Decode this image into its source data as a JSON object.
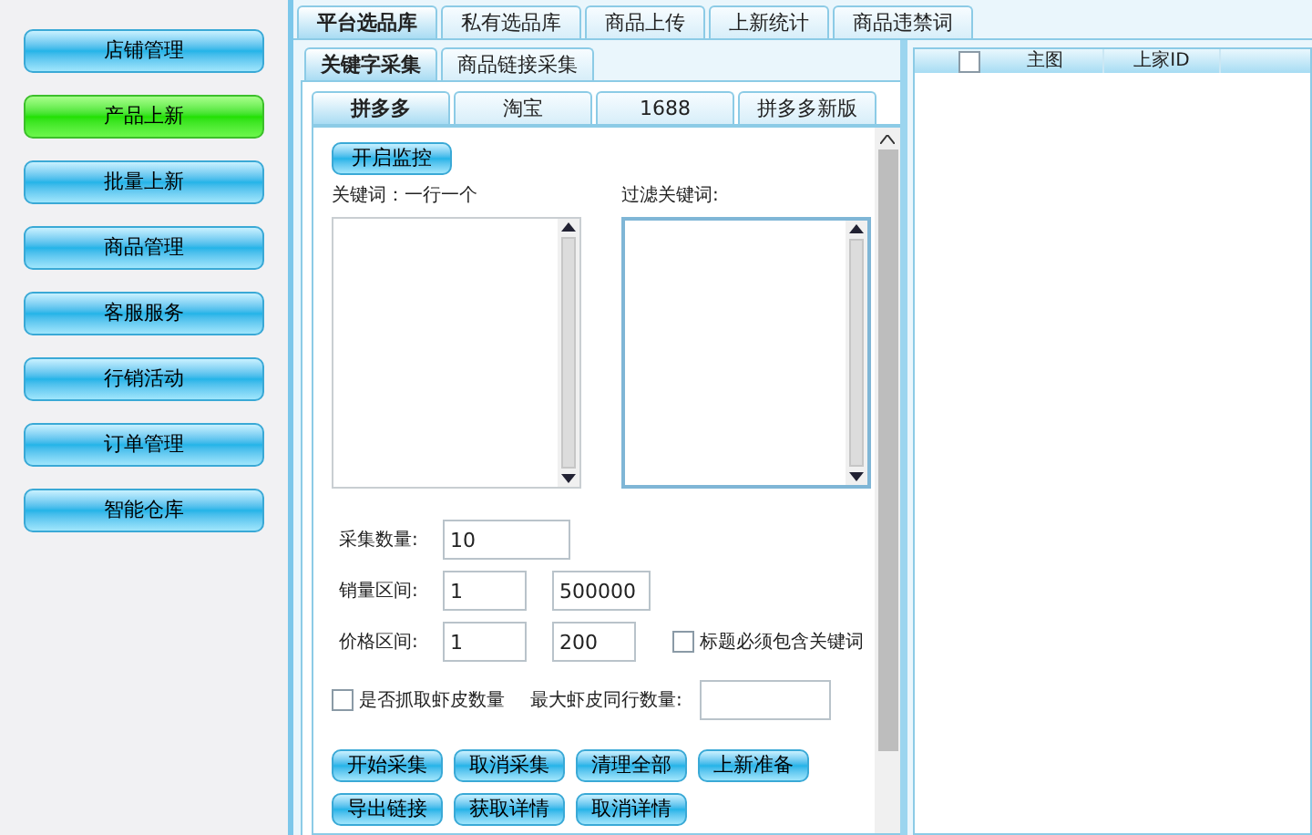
{
  "sidebar": {
    "items": [
      {
        "label": "店铺管理",
        "selected": false
      },
      {
        "label": "产品上新",
        "selected": true
      },
      {
        "label": "批量上新",
        "selected": false
      },
      {
        "label": "商品管理",
        "selected": false
      },
      {
        "label": "客服服务",
        "selected": false
      },
      {
        "label": "行销活动",
        "selected": false
      },
      {
        "label": "订单管理",
        "selected": false
      },
      {
        "label": "智能仓库",
        "selected": false
      }
    ]
  },
  "top_tabs": [
    {
      "label": "平台选品库",
      "selected": true
    },
    {
      "label": "私有选品库",
      "selected": false
    },
    {
      "label": "商品上传",
      "selected": false
    },
    {
      "label": "上新统计",
      "selected": false
    },
    {
      "label": "商品违禁词",
      "selected": false
    }
  ],
  "sub_tabs": [
    {
      "label": "关键字采集",
      "selected": true
    },
    {
      "label": "商品链接采集",
      "selected": false
    }
  ],
  "platform_tabs": [
    {
      "label": "拼多多",
      "selected": true
    },
    {
      "label": "淘宝",
      "selected": false
    },
    {
      "label": "1688",
      "selected": false
    },
    {
      "label": "拼多多新版",
      "selected": false
    }
  ],
  "monitor_button": "开启监控",
  "keywords_label": "关键词：一行一个",
  "filter_keywords_label": "过滤关键词:",
  "collect_count": {
    "label": "采集数量:",
    "value": "10"
  },
  "sales_range": {
    "label": "销量区间:",
    "min": "1",
    "max": "500000"
  },
  "price_range": {
    "label": "价格区间:",
    "min": "1",
    "max": "200"
  },
  "title_must_contain": {
    "label": "标题必须包含关键词",
    "checked": false
  },
  "fetch_shopee_count": {
    "label": "是否抓取虾皮数量",
    "checked": false
  },
  "max_shopee_peers": {
    "label": "最大虾皮同行数量:"
  },
  "action_buttons": [
    [
      "开始采集",
      "取消采集",
      "清理全部",
      "上新准备"
    ],
    [
      "导出链接",
      "获取详情",
      "取消详情"
    ]
  ],
  "table": {
    "select_all_checked": false,
    "columns": [
      "主图",
      "上家ID"
    ]
  }
}
